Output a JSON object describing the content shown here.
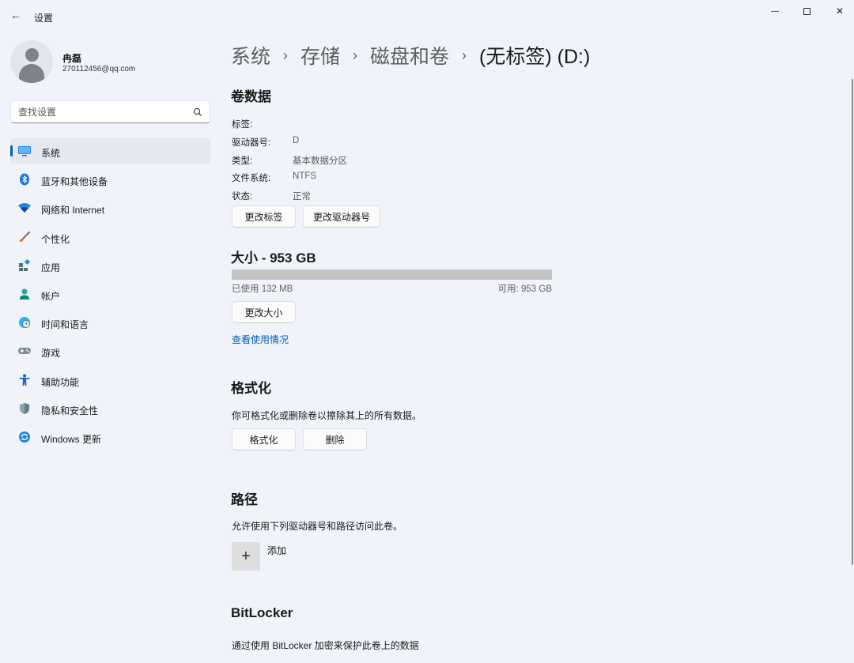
{
  "window": {
    "title": "设置",
    "back_glyph": "←",
    "minimize_glyph": "—",
    "close_glyph": "✕"
  },
  "profile": {
    "name": "冉磊",
    "email": "270112456@qq.com"
  },
  "search": {
    "placeholder": "查找设置"
  },
  "sidebar": {
    "items": [
      {
        "label": "系统",
        "icon": "monitor-icon",
        "active": true
      },
      {
        "label": "蓝牙和其他设备",
        "icon": "bluetooth-icon"
      },
      {
        "label": "网络和 Internet",
        "icon": "wifi-icon"
      },
      {
        "label": "个性化",
        "icon": "brush-icon"
      },
      {
        "label": "应用",
        "icon": "apps-icon"
      },
      {
        "label": "帐户",
        "icon": "person-icon"
      },
      {
        "label": "时间和语言",
        "icon": "globe-clock-icon"
      },
      {
        "label": "游戏",
        "icon": "gamepad-icon"
      },
      {
        "label": "辅助功能",
        "icon": "accessibility-icon"
      },
      {
        "label": "隐私和安全性",
        "icon": "shield-icon"
      },
      {
        "label": "Windows 更新",
        "icon": "update-icon"
      }
    ]
  },
  "breadcrumb": {
    "items": [
      "系统",
      "存储",
      "磁盘和卷",
      "(无标签) (D:)"
    ],
    "separator": "›"
  },
  "volume": {
    "title": "卷数据",
    "rows": [
      {
        "label": "标签:",
        "value": ""
      },
      {
        "label": "驱动器号:",
        "value": "D"
      },
      {
        "label": "类型:",
        "value": "基本数据分区"
      },
      {
        "label": "文件系统:",
        "value": "NTFS"
      },
      {
        "label": "状态:",
        "value": "正常"
      }
    ],
    "change_label_button": "更改标签",
    "change_letter_button": "更改驱动器号"
  },
  "size": {
    "title": "大小 - 953 GB",
    "used_text": "已使用 132 MB",
    "free_text": "可用: 953 GB",
    "used_fraction": 0.0001,
    "resize_button": "更改大小",
    "usage_link": "查看使用情况"
  },
  "format": {
    "title": "格式化",
    "description": "你可格式化或删除卷以擦除其上的所有数据。",
    "format_button": "格式化",
    "delete_button": "删除"
  },
  "paths": {
    "title": "路径",
    "description": "允许使用下列驱动器号和路径访问此卷。",
    "add_glyph": "+",
    "add_label": "添加"
  },
  "bitlocker": {
    "title": "BitLocker",
    "description": "通过使用 BitLocker 加密来保护此卷上的数据"
  },
  "colors": {
    "accent": "#005fb8",
    "background": "#f0f3f9",
    "bar_free": "#c3c3c3",
    "bar_used": "#6e6e6e"
  }
}
